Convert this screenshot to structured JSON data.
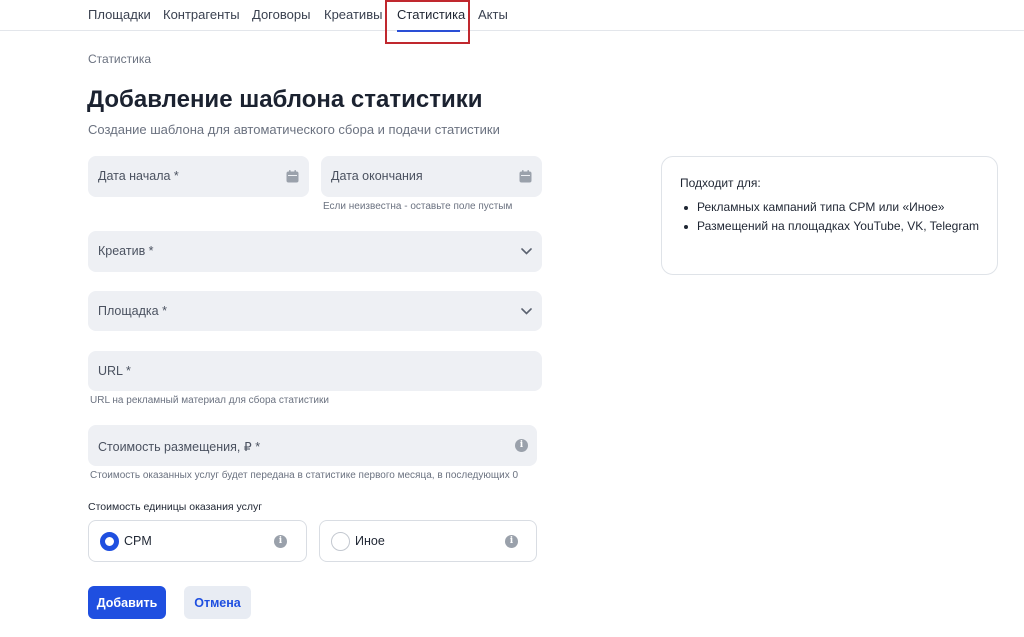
{
  "nav": {
    "items": [
      {
        "label": "Площадки"
      },
      {
        "label": "Контрагенты"
      },
      {
        "label": "Договоры"
      },
      {
        "label": "Креативы"
      },
      {
        "label": "Статистика",
        "active": true
      },
      {
        "label": "Акты"
      }
    ]
  },
  "breadcrumb": "Статистика",
  "title": "Добавление шаблона статистики",
  "subtitle": "Создание шаблона для автоматического сбора и подачи статистики",
  "form": {
    "start_date": {
      "placeholder": "Дата начала *",
      "icon": "calendar-icon"
    },
    "end_date": {
      "placeholder": "Дата окончания",
      "icon": "calendar-icon",
      "hint": "Если неизвестна - оставьте поле пустым"
    },
    "creative": {
      "placeholder": "Креатив *",
      "icon": "chevron-down-icon"
    },
    "platform": {
      "placeholder": "Площадка *",
      "icon": "chevron-down-icon"
    },
    "url": {
      "placeholder": "URL *",
      "hint": "URL на рекламный материал для сбора статистики"
    },
    "cost": {
      "placeholder": "Стоимость размещения, ₽ *",
      "icon": "info-icon",
      "hint": "Стоимость оказанных услуг будет передана в статистике первого месяца, в последующих 0"
    },
    "unit_cost": {
      "label": "Стоимость единицы оказания услуг",
      "options": [
        {
          "label": "CPM",
          "selected": true
        },
        {
          "label": "Иное",
          "selected": false
        }
      ]
    }
  },
  "buttons": {
    "submit": "Добавить",
    "cancel": "Отмена"
  },
  "info": {
    "title": "Подходит для:",
    "items": [
      "Рекламных кампаний типа CPM или «Иное»",
      "Размещений на площадках YouTube, VK, Telegram"
    ]
  },
  "colors": {
    "accent": "#1f4fe0",
    "field_bg": "#eef0f4",
    "highlight": "#c0282e"
  }
}
